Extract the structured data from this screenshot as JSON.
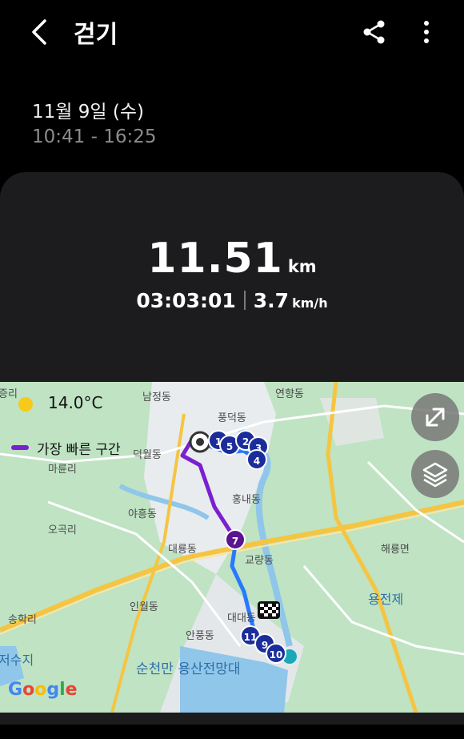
{
  "header": {
    "title": "걷기",
    "back_icon": "chevron-left-icon",
    "share_icon": "share-icon",
    "more_icon": "more-vertical-icon"
  },
  "session": {
    "date": "11월 9일 (수)",
    "time_range": "10:41 - 16:25"
  },
  "summary": {
    "distance": "11.51",
    "distance_unit": "km",
    "duration": "03:03:01",
    "speed": "3.7",
    "speed_unit": "km/h"
  },
  "map": {
    "weather_icon": "sun-icon",
    "temperature": "14.0°C",
    "legend_label": "가장 빠른 구간",
    "legend_color": "#7b1fd0",
    "route_color": "#2979ff",
    "fast_segment_color": "#7b1fd0",
    "google_logo": "Google",
    "places": [
      "증리",
      "남정동",
      "연향동",
      "풍덕동",
      "덕월동",
      "마륜리",
      "야흥동",
      "홍내동",
      "오곡리",
      "대룡동",
      "교량동",
      "해룡면",
      "인월동",
      "용전제",
      "송학리",
      "대대동",
      "안풍동",
      "저수지",
      "순천만 용산전망대"
    ],
    "markers": [
      "1",
      "5",
      "2",
      "3",
      "4",
      "7",
      "11",
      "9",
      "10"
    ]
  }
}
